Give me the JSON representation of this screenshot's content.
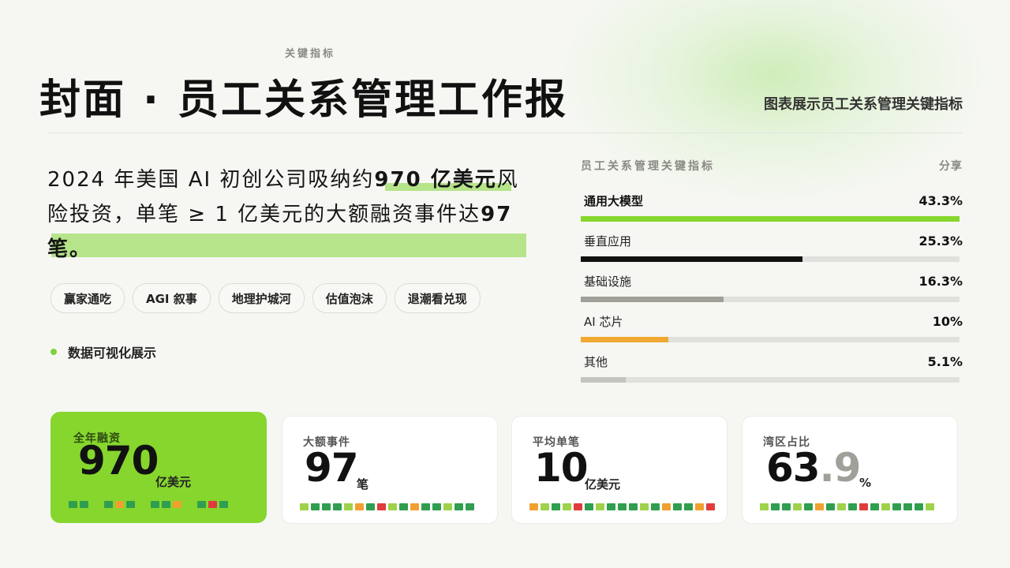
{
  "header": {
    "eyebrow": "关键指标",
    "title": "封面 · 员工关系管理工作报",
    "subtitle": "图表展示员工关系管理关键指标"
  },
  "headline": {
    "part1": "2024 年美国 AI 初创公司吸纳约",
    "highlight1": "970 亿美元",
    "part2": "风险投资，单笔 ≥ 1 亿美元的大额融资事件达",
    "highlight2": "97",
    "part3": "笔。"
  },
  "tags": [
    "赢家通吃",
    "AGI 叙事",
    "地理护城河",
    "估值泡沫",
    "退潮看兑现"
  ],
  "viz_label": "数据可视化展示",
  "panel": {
    "title": "员工关系管理关键指标",
    "share_label": "分享",
    "items": [
      {
        "name": "通用大模型",
        "value": "43.3%",
        "pct": 43.3,
        "color": "#86d62e",
        "bold": true
      },
      {
        "name": "垂直应用",
        "value": "25.3%",
        "pct": 25.3,
        "color": "#111111",
        "bold": false
      },
      {
        "name": "基础设施",
        "value": "16.3%",
        "pct": 16.3,
        "color": "#a0a098",
        "bold": false
      },
      {
        "name": "AI 芯片",
        "value": "10%",
        "pct": 10,
        "color": "#f0a830",
        "bold": false
      },
      {
        "name": "其他",
        "value": "5.1%",
        "pct": 5.1,
        "color": "#c4c4be",
        "bold": false
      }
    ]
  },
  "cards": [
    {
      "label": "全年融资",
      "value": "970",
      "decimal": "",
      "unit": "亿美元"
    },
    {
      "label": "大额事件",
      "value": "97",
      "decimal": "",
      "unit": "笔"
    },
    {
      "label": "平均单笔",
      "value": "10",
      "decimal": "",
      "unit": "亿美元"
    },
    {
      "label": "湾区占比",
      "value": "63",
      "decimal": ".9",
      "unit": "%"
    }
  ],
  "colors": {
    "accent_green": "#86d62e",
    "highlight": "#b6e48a",
    "square_green_dark": "#2f9e4f",
    "square_green_light": "#9fd24a",
    "square_orange": "#f0a030",
    "square_red": "#e03c3c"
  }
}
